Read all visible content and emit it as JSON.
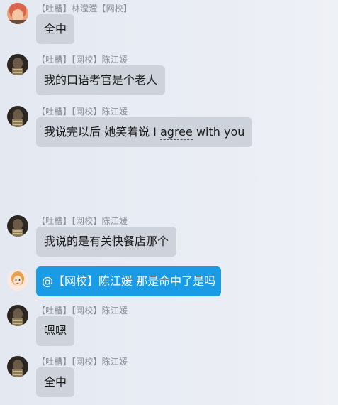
{
  "messages": [
    {
      "sender": "【吐槽】林滢滢【网校】",
      "text": "全中",
      "avatar": "avatar-orange-haired"
    },
    {
      "sender": "【吐槽】【网校】陈江媛",
      "text": "我的口语考官是个老人",
      "avatar": "avatar-dark"
    },
    {
      "sender": "【吐槽】【网校】陈江媛",
      "text_parts": [
        "我说完以后 她笑着说 I ",
        "agree",
        " with you"
      ],
      "avatar": "avatar-dark"
    },
    {
      "sender": "【吐槽】【网校】陈江媛",
      "text_parts": [
        "我说的是有关",
        "快餐店",
        "那个"
      ],
      "avatar": "avatar-dark"
    },
    {
      "sender": "",
      "text": "@【网校】陈江媛 那是命中了是吗",
      "avatar": "avatar-cartoon-self",
      "mine": true
    },
    {
      "sender": "【吐槽】【网校】陈江媛",
      "text": "嗯嗯",
      "avatar": "avatar-dark"
    },
    {
      "sender": "【吐槽】【网校】陈江媛",
      "text": "全中",
      "avatar": "avatar-dark"
    }
  ],
  "colors": {
    "incoming_bubble": "#ced3db",
    "outgoing_bubble": "#1a9be6",
    "sender_text": "#8a8f99"
  }
}
